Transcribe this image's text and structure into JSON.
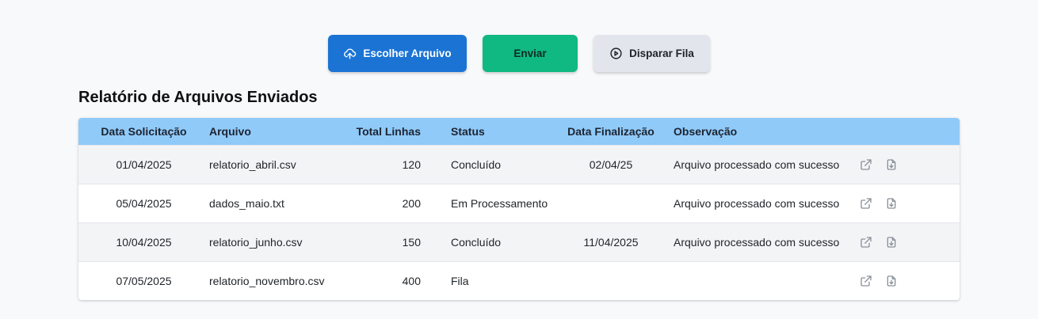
{
  "toolbar": {
    "choose_file_label": "Escolher Arquivo",
    "send_label": "Enviar",
    "trigger_queue_label": "Disparar Fila"
  },
  "report": {
    "title": "Relatório de Arquivos Enviados",
    "columns": [
      "Data Solicitação",
      "Arquivo",
      "Total Linhas",
      "Status",
      "Data Finalização",
      "Observação"
    ],
    "rows": [
      {
        "requested": "01/04/2025",
        "file": "relatorio_abril.csv",
        "lines": "120",
        "status": "Concluído",
        "finished": "02/04/25",
        "note": "Arquivo processado com sucesso"
      },
      {
        "requested": "05/04/2025",
        "file": "dados_maio.txt",
        "lines": "200",
        "status": "Em Processamento",
        "finished": "",
        "note": "Arquivo processado com sucesso"
      },
      {
        "requested": "10/04/2025",
        "file": "relatorio_junho.csv",
        "lines": "150",
        "status": "Concluído",
        "finished": "11/04/2025",
        "note": "Arquivo processado com sucesso"
      },
      {
        "requested": "07/05/2025",
        "file": "relatorio_novembro.csv",
        "lines": "400",
        "status": "Fila",
        "finished": "",
        "note": ""
      }
    ]
  },
  "icons": {
    "upload": "cloud-upload-icon",
    "play": "play-circle-icon",
    "open": "external-link-icon",
    "download": "file-download-icon"
  },
  "colors": {
    "primary": "#1b74d4",
    "success": "#10b981",
    "light": "#e2e6ec",
    "header": "#90caf9"
  }
}
